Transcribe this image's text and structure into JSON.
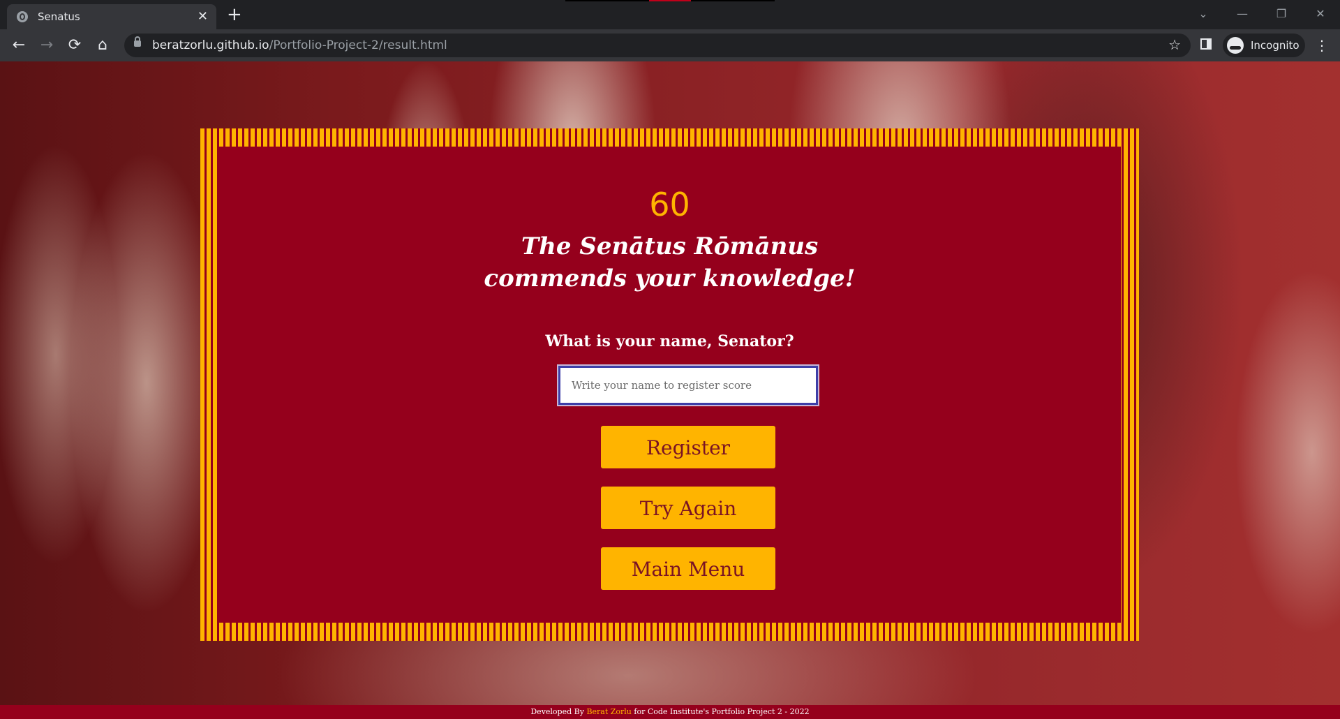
{
  "browser": {
    "tab_title": "Senatus",
    "tab_close": "✕",
    "new_tab": "+",
    "url_host": "beratzorlu.github.io",
    "url_path": "/Portfolio-Project-2/result.html",
    "profile_label": "Incognito",
    "window_controls": {
      "dropdown": "⌄",
      "minimize": "—",
      "restore": "❐",
      "close": "✕"
    },
    "nav": {
      "back": "←",
      "forward": "→",
      "reload": "⟳",
      "home": "⌂",
      "star": "☆",
      "menu": "⋮"
    }
  },
  "result": {
    "score": "60",
    "headline_line1": "The Senātus Rōmānus",
    "headline_line2": "commends your knowledge!",
    "prompt": "What is your name, Senator?",
    "name_placeholder": "Write your name to register score",
    "name_value": ""
  },
  "buttons": {
    "register": "Register",
    "try_again": "Try Again",
    "main_menu": "Main Menu"
  },
  "footer": {
    "prefix": "Developed By ",
    "author": "Berat Zorlu",
    "suffix": " for Code Institute's Portfolio Project 2 - 2022"
  },
  "colors": {
    "panel_bg": "#95001c",
    "accent_gold": "#ffb400",
    "button_text": "#7a1324"
  },
  "icons": [
    "globe-icon",
    "close-icon",
    "plus-icon",
    "back-arrow-icon",
    "forward-arrow-icon",
    "reload-icon",
    "home-icon",
    "lock-icon",
    "star-icon",
    "side-panel-icon",
    "incognito-icon",
    "kebab-menu-icon"
  ]
}
